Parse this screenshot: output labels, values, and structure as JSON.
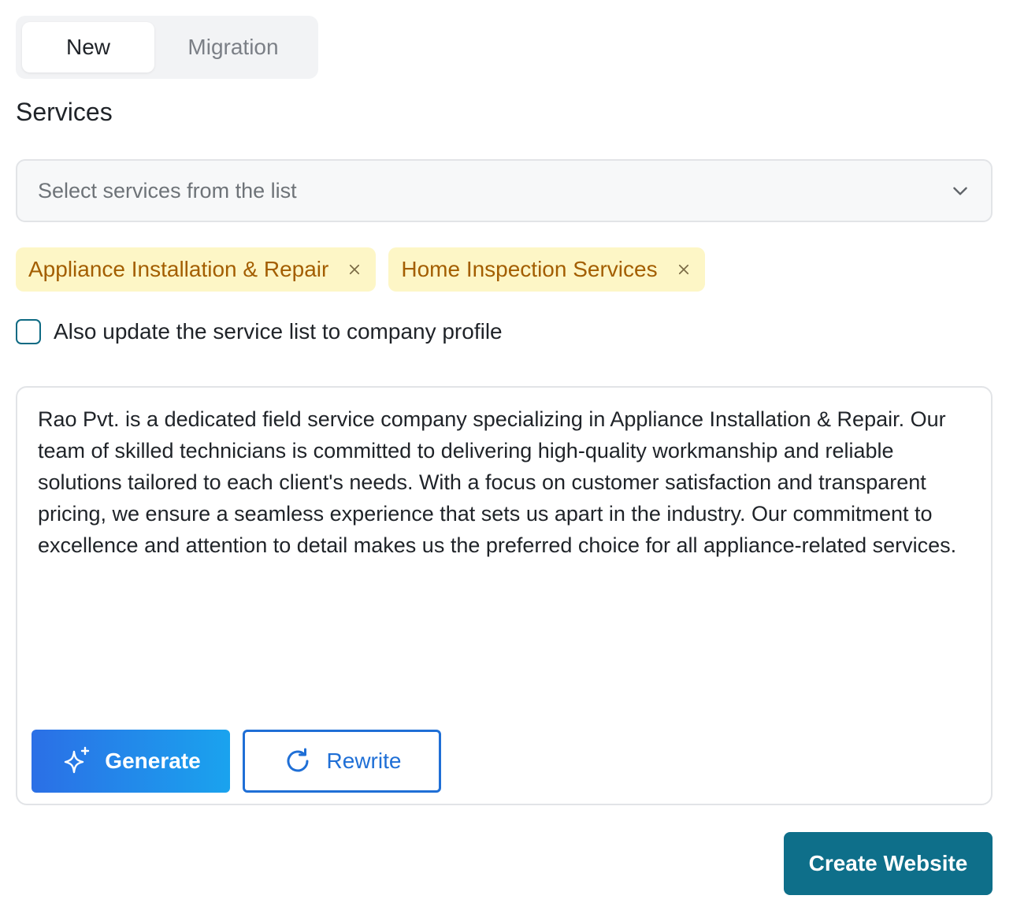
{
  "tabs": [
    {
      "label": "New",
      "active": true
    },
    {
      "label": "Migration",
      "active": false
    }
  ],
  "services": {
    "title": "Services",
    "placeholder": "Select services from the list",
    "chips": [
      {
        "label": "Appliance Installation & Repair"
      },
      {
        "label": "Home Inspection Services"
      }
    ]
  },
  "update_profile": {
    "label": "Also update the service list to company profile",
    "checked": false
  },
  "description": {
    "text": "Rao Pvt. is a dedicated field service company specializing in Appliance Installation & Repair. Our team of skilled technicians is committed to delivering high-quality workmanship and reliable solutions tailored to each client's needs. With a focus on customer satisfaction and transparent pricing, we ensure a seamless experience that sets us apart in the industry. Our commitment to excellence and attention to detail makes us the preferred choice for all appliance-related services."
  },
  "actions": {
    "generate_label": "Generate",
    "rewrite_label": "Rewrite",
    "create_label": "Create Website"
  },
  "icons": {
    "generate": "sparkle-icon",
    "rewrite": "refresh-icon",
    "select": "chevron-down-icon",
    "chip_remove": "close-icon"
  },
  "colors": {
    "chip_bg": "#fdf6c6",
    "chip_text": "#a35e00",
    "primary": "#0e6f8a",
    "accent_blue": "#1f6fd6"
  }
}
